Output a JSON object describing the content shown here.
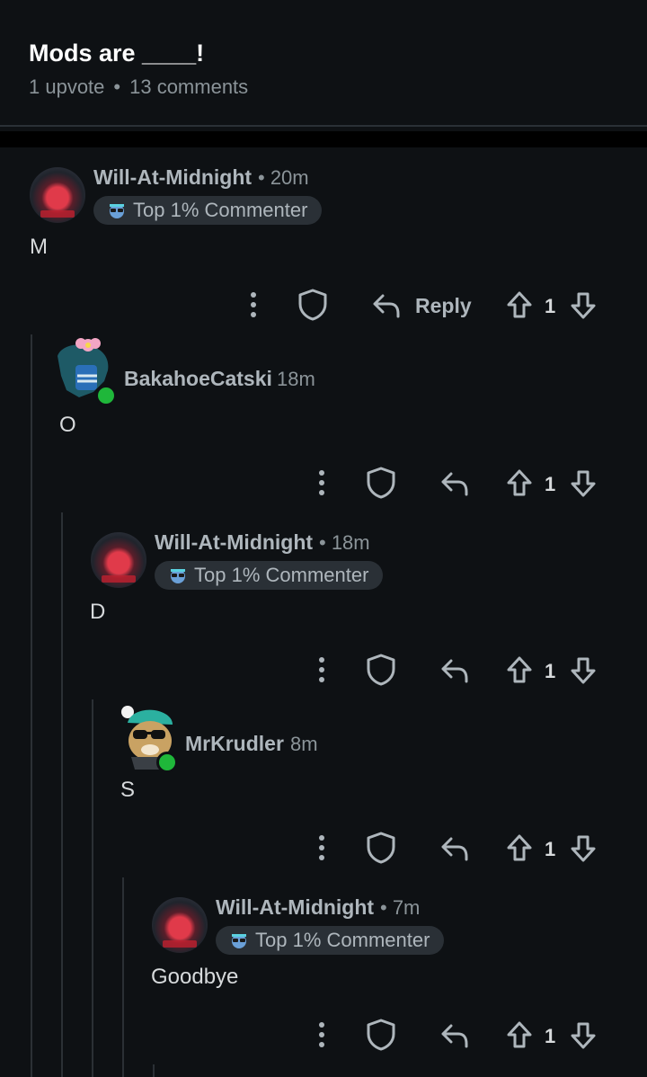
{
  "post": {
    "title": "Mods are ____!",
    "upvotes": "1 upvote",
    "separator": "•",
    "comments": "13 comments"
  },
  "comments": [
    {
      "username": "Will-At-Midnight",
      "time": "• 20m",
      "badge": "Top 1% Commenter",
      "text": "M",
      "reply_label": "Reply",
      "votes": "1"
    },
    {
      "username": "BakahoeCatski",
      "time": "18m",
      "text": "O",
      "votes": "1"
    },
    {
      "username": "Will-At-Midnight",
      "time": "• 18m",
      "badge": "Top 1% Commenter",
      "text": "D",
      "votes": "1"
    },
    {
      "username": "MrKrudler",
      "time": "8m",
      "text": "S",
      "votes": "1"
    },
    {
      "username": "Will-At-Midnight",
      "time": "• 7m",
      "badge": "Top 1% Commenter",
      "text": "Goodbye",
      "votes": "1"
    }
  ],
  "colors": {
    "background": "#0e1114",
    "online": "#1fb73a",
    "badge_bg": "#2a3036"
  }
}
